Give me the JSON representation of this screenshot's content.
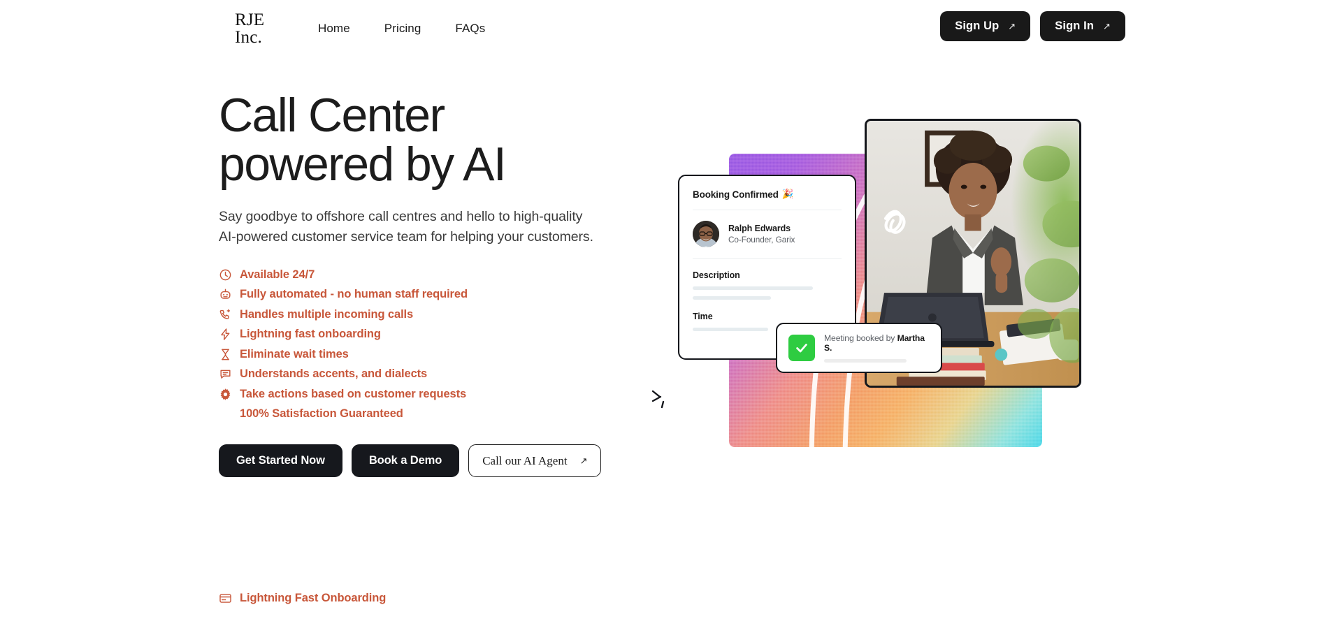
{
  "brand": {
    "logo_line1": "RJE",
    "logo_line2": "Inc."
  },
  "nav": {
    "items": [
      {
        "label": "Home"
      },
      {
        "label": "Pricing"
      },
      {
        "label": "FAQs"
      }
    ]
  },
  "header_actions": {
    "sign_up": "Sign Up",
    "sign_in": "Sign In",
    "arrow_glyph": "↗"
  },
  "hero": {
    "headline": "Call Center\npowered by AI",
    "subhead": "Say goodbye to offshore call centres and hello to high-quality\nAI-powered customer service team for helping your customers.",
    "features": [
      {
        "icon": "clock-icon",
        "label": "Available 24/7"
      },
      {
        "icon": "robot-icon",
        "label": "Fully automated - no human staff required"
      },
      {
        "icon": "phone-plus-icon",
        "label": "Handles multiple incoming calls"
      },
      {
        "icon": "lightning-icon",
        "label": "Lightning fast onboarding"
      },
      {
        "icon": "hourglass-icon",
        "label": "Eliminate wait times"
      },
      {
        "icon": "chat-bubble-icon",
        "label": "Understands accents, and dialects"
      },
      {
        "icon": "gear-icon",
        "label": "Take actions based on customer requests"
      },
      {
        "icon": "none",
        "label": "100% Satisfaction Guaranteed"
      }
    ],
    "cta": {
      "primary": "Get Started Now",
      "secondary": "Book a Demo",
      "tertiary": "Call our AI Agent",
      "tertiary_arrow": "↗"
    }
  },
  "bottom_strip": {
    "icon": "card-icon",
    "label": "Lightning Fast Onboarding"
  },
  "illustration": {
    "booking_card": {
      "title": "Booking Confirmed",
      "title_emoji": "🎉",
      "person_name": "Ralph Edwards",
      "person_role": "Co-Founder, Garix",
      "description_label": "Description",
      "time_label": "Time"
    },
    "toast": {
      "text_prefix": "Meeting booked by ",
      "booker": "Martha S."
    },
    "photo_alt": "woman-at-desk-with-laptop"
  },
  "colors": {
    "accent_orange": "#c8573a",
    "dark": "#16181d",
    "green": "#2ecc41",
    "page_bg": "#ffffff",
    "gradient_start": "#9b5de5",
    "gradient_mid": "#f4a06a",
    "gradient_end": "#4fd8e8"
  }
}
